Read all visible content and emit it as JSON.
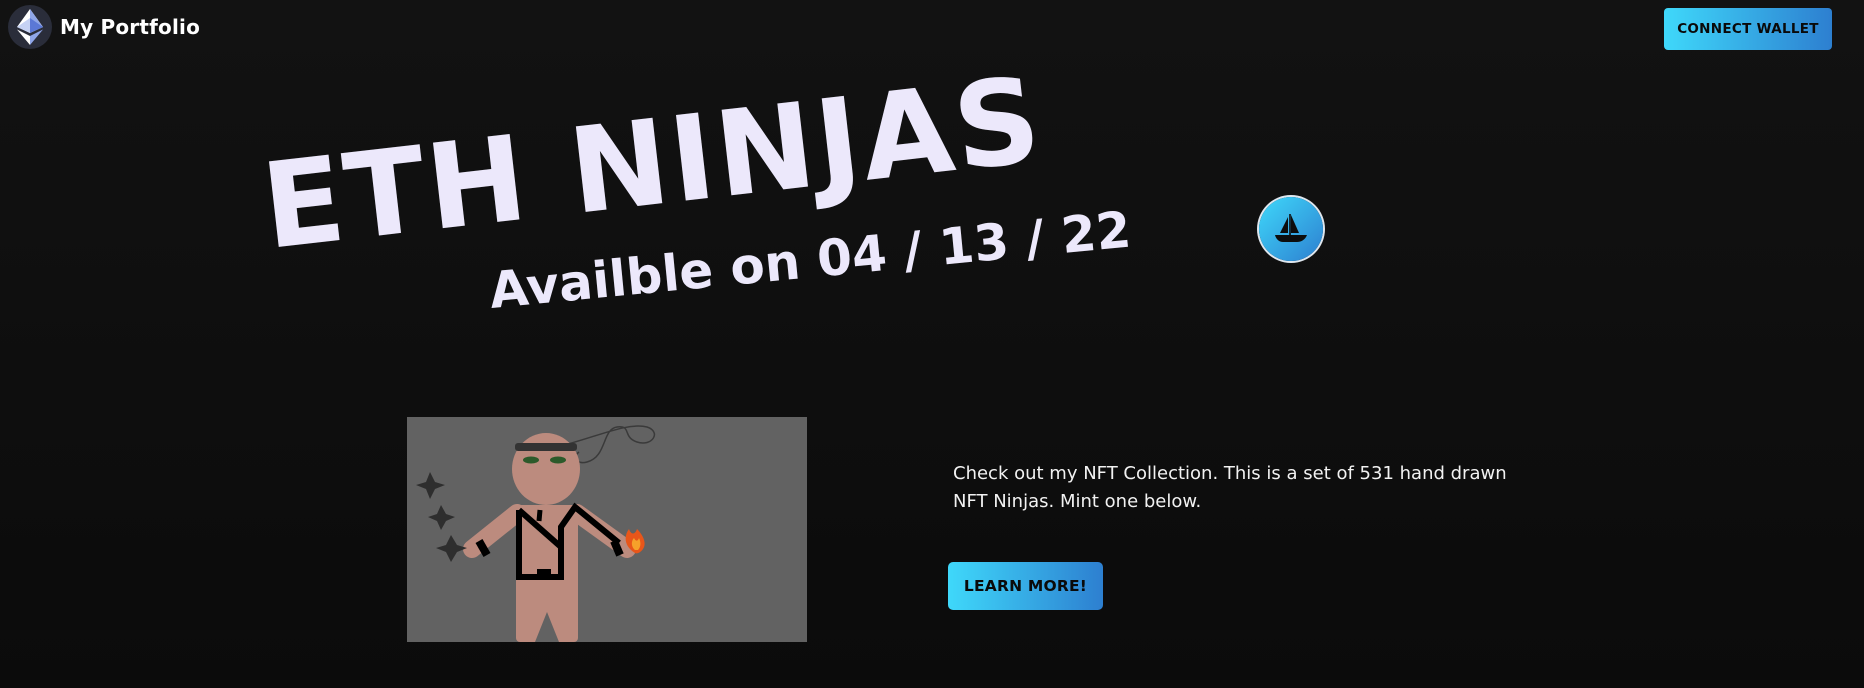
{
  "navbar": {
    "brand_name": "My Portfolio",
    "logo_icon": "ethereum-icon",
    "connect_label": "CONNECT WALLET"
  },
  "hero": {
    "title": "ETH NINJAS",
    "subtitle": "Availble on 04 / 13 / 22",
    "opensea_icon": "opensea-boat-icon"
  },
  "content": {
    "image_alt": "Hand-drawn ninja NFT",
    "description": "Check out my NFT Collection. This is a set of 531 hand drawn NFT Ninjas. Mint one below.",
    "learn_more_label": "LEARN MORE!"
  },
  "colors": {
    "accent_start": "#3fd8fa",
    "accent_end": "#2d7fd0",
    "background": "#0c0c0c",
    "title_color": "#ece8fb"
  }
}
